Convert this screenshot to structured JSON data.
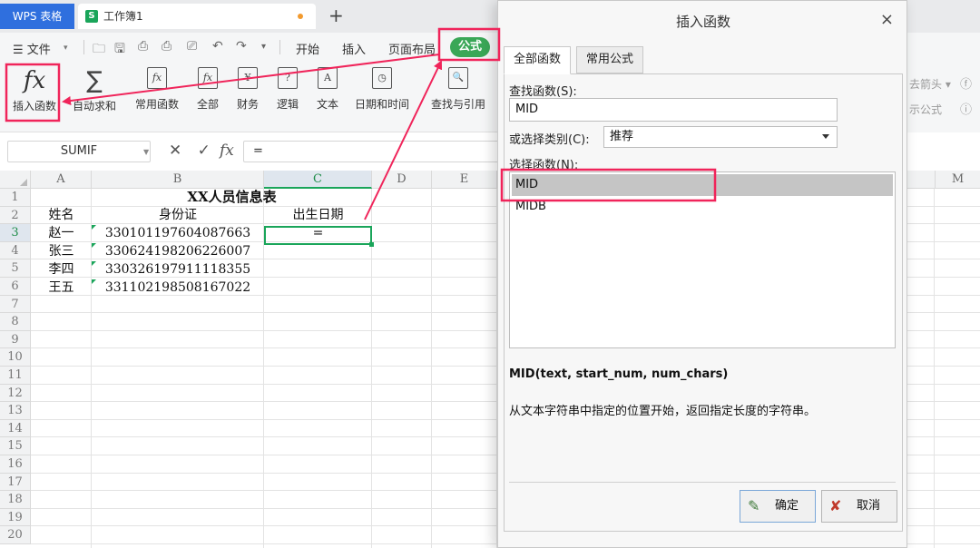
{
  "tabs": {
    "app": "WPS 表格",
    "doc_badge": "S",
    "doc": "工作簿1",
    "new": "+"
  },
  "menu": {
    "file": "☰ 文件",
    "file_caret": "▾",
    "tabs": [
      "开始",
      "插入",
      "页面布局",
      "公式"
    ]
  },
  "ribbon": {
    "insert_function": "插入函数",
    "fx_glyph": "fx",
    "autosum": "自动求和",
    "groups": [
      "常用函数",
      "全部",
      "财务",
      "逻辑",
      "文本",
      "日期和时间",
      "查找与引用"
    ],
    "group_icons": [
      "fx",
      "fx",
      "¥",
      "?",
      "A",
      "◷",
      "🔍"
    ],
    "right_faded": [
      "去箭头 ▾",
      "示公式"
    ]
  },
  "formula_bar": {
    "name_box": "SUMIF",
    "icons": "✕ ✓",
    "fx": "fx",
    "content": "="
  },
  "sheet": {
    "columns": [
      "A",
      "B",
      "C",
      "D",
      "E",
      "M"
    ],
    "active_column": "C",
    "rows": [
      "1",
      "2",
      "3",
      "4",
      "5",
      "6",
      "7",
      "8",
      "9",
      "10",
      "11",
      "12",
      "13",
      "14",
      "15",
      "16",
      "17",
      "18",
      "19",
      "20"
    ],
    "active_row": "3",
    "title": "XX人员信息表",
    "headers": [
      "姓名",
      "身份证",
      "出生日期"
    ],
    "data": [
      {
        "name": "赵一",
        "id": "330101197604087663",
        "birth": "="
      },
      {
        "name": "张三",
        "id": "330624198206226007",
        "birth": ""
      },
      {
        "name": "李四",
        "id": "330326197911118355",
        "birth": ""
      },
      {
        "name": "王五",
        "id": "331102198508167022",
        "birth": ""
      }
    ]
  },
  "dialog": {
    "title": "插入函数",
    "close": "×",
    "tabs": [
      "全部函数",
      "常用公式"
    ],
    "search_label": "查找函数(S):",
    "search_value": "MID",
    "category_label": "或选择类别(C):",
    "category_value": "推荐",
    "list_label": "选择函数(N):",
    "functions": [
      "MID",
      "MIDB"
    ],
    "selected_function": "MID",
    "signature": "MID(text, start_num, num_chars)",
    "description": "从文本字符串中指定的位置开始，返回指定长度的字符串。",
    "ok": "确定",
    "cancel": "取消"
  },
  "colors": {
    "accent_green": "#1aa55a",
    "app_tab_blue": "#2f6fde",
    "highlight_red": "#f0245a"
  }
}
